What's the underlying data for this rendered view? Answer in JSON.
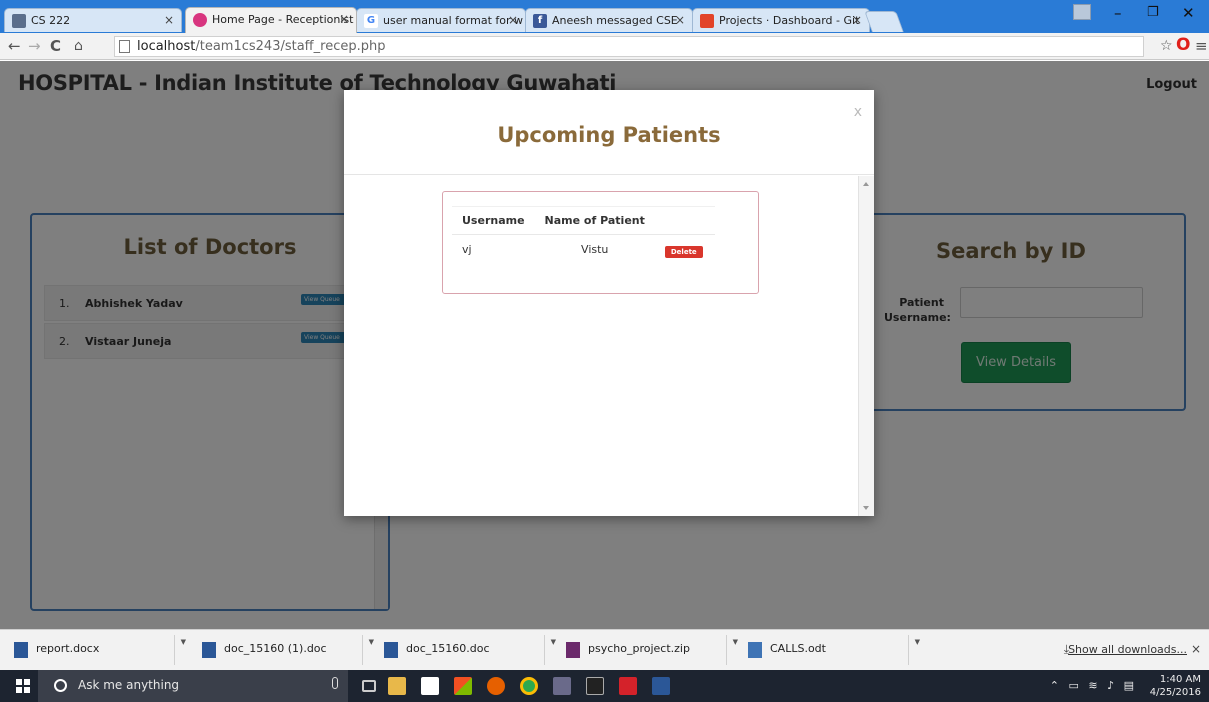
{
  "browser": {
    "tabs": [
      {
        "label": "CS 222",
        "favicon": "document-icon",
        "color": "#5a6e8c"
      },
      {
        "label": "Home Page - Receptionist",
        "favicon": "app-icon",
        "color": "#d8357f",
        "active": true
      },
      {
        "label": "user manual format for w",
        "favicon": "google-icon",
        "color": "#4285f4"
      },
      {
        "label": "Aneesh messaged CSE",
        "favicon": "facebook-icon",
        "color": "#3b5998"
      },
      {
        "label": "Projects · Dashboard - Git",
        "favicon": "gitlab-icon",
        "color": "#e24329"
      }
    ],
    "url_host": "localhost",
    "url_path": "/team1cs243/staff_recep.php"
  },
  "header": {
    "title": "HOSPITAL - Indian Institute of Technology Guwahati",
    "logout_label": "Logout"
  },
  "doctors": {
    "heading": "List of Doctors",
    "items": [
      {
        "index": "1.",
        "name": "Abhishek Yadav",
        "action": "View Queue"
      },
      {
        "index": "2.",
        "name": "Vistaar Juneja",
        "action": "View Queue"
      }
    ]
  },
  "search": {
    "heading": "Search by ID",
    "label_line1": "Patient",
    "label_line2": "Username:",
    "input_value": "",
    "button_label": "View Details",
    "button_color": "#1e9a56"
  },
  "modal": {
    "title": "Upcoming Patients",
    "close_label": "x",
    "columns": [
      "Username",
      "Name of Patient"
    ],
    "rows": [
      {
        "username": "vj",
        "name": "Vistu",
        "action": "Delete"
      }
    ],
    "delete_color": "#d9362c"
  },
  "downloads": {
    "items": [
      {
        "name": "report.docx",
        "icon": "word-doc-icon"
      },
      {
        "name": "doc_15160 (1).doc",
        "icon": "word-doc-icon"
      },
      {
        "name": "doc_15160.doc",
        "icon": "word-doc-icon"
      },
      {
        "name": "psycho_project.zip",
        "icon": "archive-icon"
      },
      {
        "name": "CALLS.odt",
        "icon": "writer-doc-icon"
      }
    ],
    "show_all_label": "Show all downloads...",
    "close_label": "×"
  },
  "taskbar": {
    "search_placeholder": "Ask me anything",
    "time": "1:40 AM",
    "date": "4/25/2016"
  }
}
